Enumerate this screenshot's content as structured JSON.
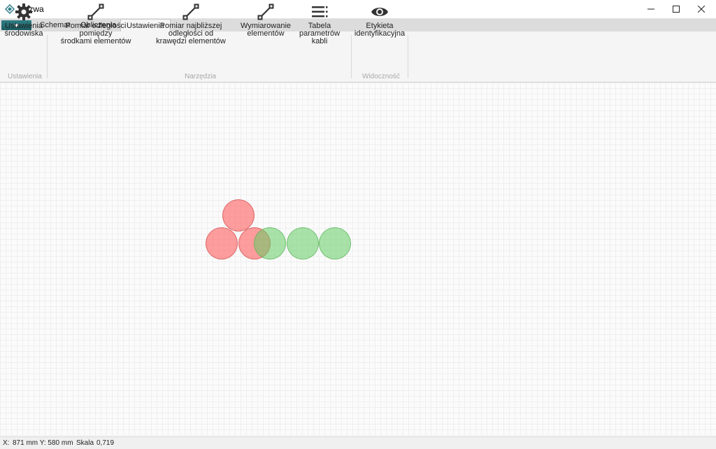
{
  "window": {
    "title": "Nazwa"
  },
  "tabs": [
    {
      "label": "Schemat",
      "active": false
    },
    {
      "label": "Obliczenia",
      "active": false
    },
    {
      "label": "Ustawienia",
      "active": true
    }
  ],
  "ribbon": {
    "groups": [
      {
        "label": "Ustawienia"
      },
      {
        "label": "Narzędzia"
      },
      {
        "label": "Widoczność"
      }
    ],
    "buttons": [
      {
        "line1": "Ustawienia",
        "line2": "środowiska",
        "icon": "gear-icon"
      },
      {
        "line1": "Pomiar odległości pomiędzy",
        "line2": "środkami elementów",
        "icon": "measure-icon"
      },
      {
        "line1": "Pomiar najbliższej odległości od",
        "line2": "krawędzi elementów",
        "icon": "measure-icon"
      },
      {
        "line1": "Wymiarowanie",
        "line2": "elementów",
        "icon": "dimension-icon"
      },
      {
        "line1": "Tabela",
        "line2": "parametrów kabli",
        "icon": "list-icon"
      },
      {
        "line1": "Etykieta",
        "line2": "identyfikacyjna",
        "icon": "eye-icon"
      }
    ]
  },
  "colors": {
    "red_element": "#ff5050",
    "green_element": "#64cd64",
    "app_menu": "#1a5a61"
  },
  "status": {
    "coords_label": "X:",
    "coords_value": "871 mm Y: 580 mm",
    "scale_label": "Skala",
    "scale_value": "0,719"
  }
}
